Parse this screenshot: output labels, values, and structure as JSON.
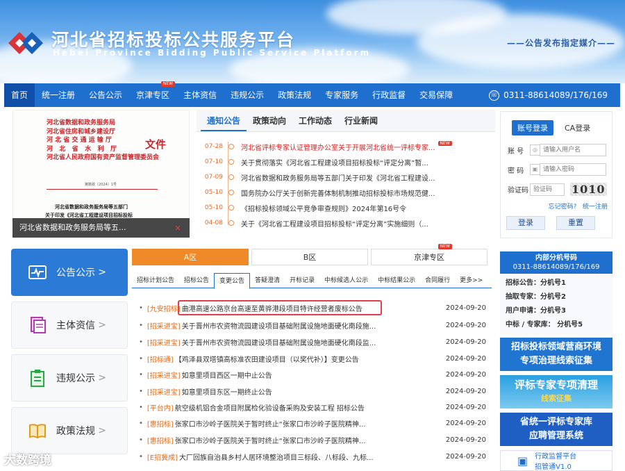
{
  "header": {
    "title": "河北省招标投标公共服务平台",
    "subtitle": "Hebei Province Bidding Public Service Platform",
    "slogan": "——公告发布指定媒介——"
  },
  "nav": {
    "items": [
      {
        "label": "首页",
        "active": true
      },
      {
        "label": "统一注册"
      },
      {
        "label": "公告公示"
      },
      {
        "label": "京津专区",
        "badge": "NEW"
      },
      {
        "label": "主体资信"
      },
      {
        "label": "违规公示"
      },
      {
        "label": "政策法规"
      },
      {
        "label": "专家服务"
      },
      {
        "label": "行政监督"
      },
      {
        "label": "交易保障"
      }
    ],
    "phone": "0311-88614089/176/169"
  },
  "feature_doc": {
    "header_lines": "河北省数据和政务服务局\n河北省住房和城乡建设厅\n河 北 省 交 通 运 输 厅\n河   北   省   水   利   厅\n河北省人民政府国有资产监督管理委员会",
    "wen": "文件",
    "doc_no": "冀数政〔2024〕1号",
    "title1": "河北省数据和政务服务局等五部门",
    "title2": "关于印发《河北省工程建设项目招标投标",
    "caption": "河北省数据和政务服务局等五...",
    "close": "×"
  },
  "news": {
    "tabs": [
      "通知公告",
      "政策动向",
      "工作动态",
      "行业新闻"
    ],
    "items": [
      {
        "date": "07-28",
        "title": "河北省评标专家认证管理办公室关于开展河北省统一评标专家...",
        "badge": "NEW",
        "red": true
      },
      {
        "date": "07-10",
        "title": "关于贯彻落实《河北省工程建设项目招标投标“评定分离”暂..."
      },
      {
        "date": "07-09",
        "title": "河北省数据和政务服务局等五部门关于印发《河北省工程建设..."
      },
      {
        "date": "05-10",
        "title": "国务院办公厅关于创新完善体制机制推动招标投标市场规范健..."
      },
      {
        "date": "05-10",
        "title": "《招标投标领域公平竞争审查规则》2024年第16号令"
      },
      {
        "date": "04-08",
        "title": "关于《河北省工程建设项目招标投标“评定分离”实施细则（..."
      }
    ]
  },
  "login": {
    "tabs": [
      "账号登录",
      "CA登录"
    ],
    "account_label": "账  号",
    "account_placeholder": "请输入用户名",
    "password_label": "密  码",
    "password_placeholder": "请输入密码",
    "captcha_label": "验证码",
    "captcha_placeholder": "验证码",
    "captcha_text": "1010",
    "forgot": "忘记密码?",
    "register": "统一注册",
    "login_btn": "登录",
    "reset_btn": "重置"
  },
  "side_menu": [
    {
      "label": "公告公示",
      "icon": "pulse-icon",
      "active": true
    },
    {
      "label": "主体资信",
      "icon": "document-icon"
    },
    {
      "label": "违规公示",
      "icon": "clipboard-icon"
    },
    {
      "label": "政策法规",
      "icon": "book-icon"
    }
  ],
  "zones": [
    {
      "label": "A区",
      "active": true
    },
    {
      "label": "B区"
    },
    {
      "label": "京津专区",
      "badge": "NEW"
    }
  ],
  "subtabs": [
    "招标计划公告",
    "招标公告",
    "变更公告",
    "答疑澄清",
    "开标记录",
    "中标候选人公示",
    "中标结果公示",
    "合同履行",
    "更多>>"
  ],
  "subtab_active": "变更公告",
  "announcements": [
    {
      "tag": "[九安招标]",
      "title": "曲港高速公路京台高速至黄骅港段项目特许经营者废标公告",
      "date": "2024-09-20"
    },
    {
      "tag": "[招采进宝]",
      "title": "关于晋州市农资物流园建设项目基础附属设施地面硬化南段施...",
      "date": "2024-09-20"
    },
    {
      "tag": "[招采进宝]",
      "title": "关于晋州市农资物流园建设项目基础附属设施地面硬化南段监...",
      "date": "2024-09-20"
    },
    {
      "tag": "[招标通]",
      "title": "【鸡泽县双塔镇高标准农田建设项目（以奖代补）】变更公告",
      "date": "2024-09-20"
    },
    {
      "tag": "[招采进宝]",
      "title": "如意里项目西区一期中止公告",
      "date": "2024-09-20"
    },
    {
      "tag": "[招采进宝]",
      "title": "如意里项目东区一期终止公告",
      "date": "2024-09-20"
    },
    {
      "tag": "[平台内]",
      "title": "航空级机铝合金项目附属检化验设备采购及安装工程 招标公告",
      "date": "2024-09-20"
    },
    {
      "tag": "[惠招标]",
      "title": "张家口市沙岭子医院关于暂时终止“张家口市沙岭子医院精神...",
      "date": "2024-09-20"
    },
    {
      "tag": "[惠招标]",
      "title": "张家口市沙岭子医院关于暂时终止“张家口市沙岭子医院精神...",
      "date": "2024-09-20"
    },
    {
      "tag": "[E招冀成]",
      "title": "大厂回族自治县乡村人居环境整治项目三标段、八标段、九标...",
      "date": "2024-09-20"
    }
  ],
  "extension": {
    "title": "内部分机号码",
    "phone": "0311-88614089/176/169",
    "rows": [
      "招标公告：分机号1",
      "抽取专家：分机号2",
      "用户申请：分机号3",
      "中标 / 专家库： 分机号5"
    ]
  },
  "banners": [
    {
      "line1": "招标投标领域营商环境",
      "line2": "专项治理线索征集",
      "color": "#1f75cf"
    },
    {
      "line1": "评标专家专项清理",
      "line2": "线索征集",
      "color": "#2a9fe0"
    },
    {
      "line1": "省统一评标专家库",
      "line2": "应聘管理系统",
      "color": "#1f5fc4"
    }
  ],
  "bottom_card": {
    "line1": "行政监督平台",
    "line2": "招管通V1.0"
  },
  "watermark": "大数跨境"
}
